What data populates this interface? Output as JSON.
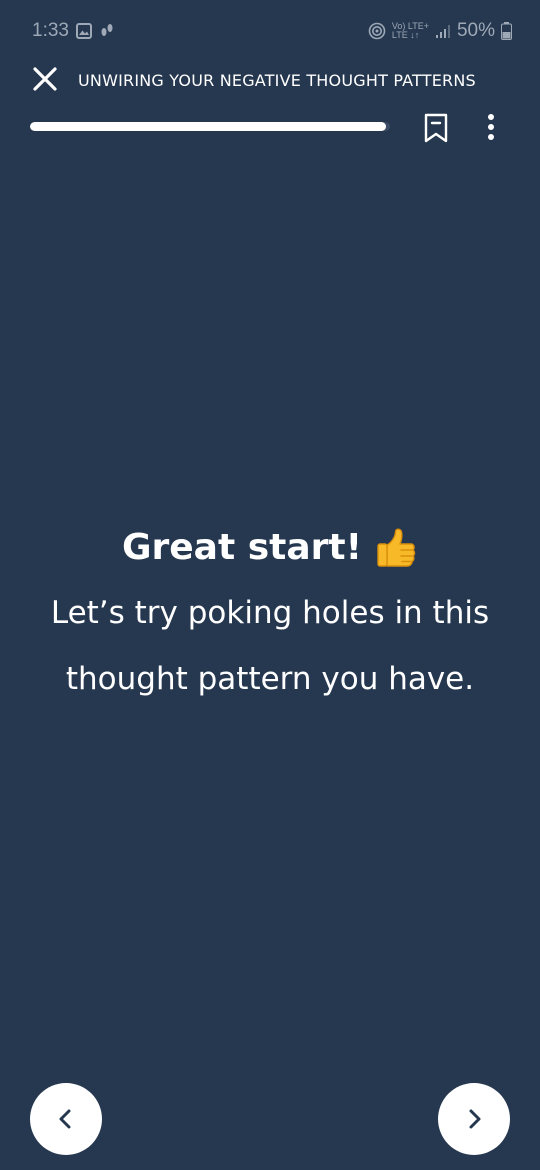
{
  "status_bar": {
    "time": "1:33",
    "network_top": "Vo) LTE+",
    "network_bottom": "LTE ↓↑",
    "battery": "50%"
  },
  "header": {
    "title": "UNWIRING YOUR NEGATIVE THOUGHT PATTERNS",
    "progress_fraction": 0.99
  },
  "content": {
    "headline": "Great start!",
    "headline_emoji": "thumbs-up",
    "body_line_1": "Let’s try poking holes in this",
    "body_line_2": "thought pattern you have."
  },
  "navigation": {
    "prev_icon": "chevron-left-icon",
    "next_icon": "chevron-right-icon"
  },
  "colors": {
    "background": "#263850",
    "text": "#ffffff",
    "thumb": "#f7b928"
  }
}
